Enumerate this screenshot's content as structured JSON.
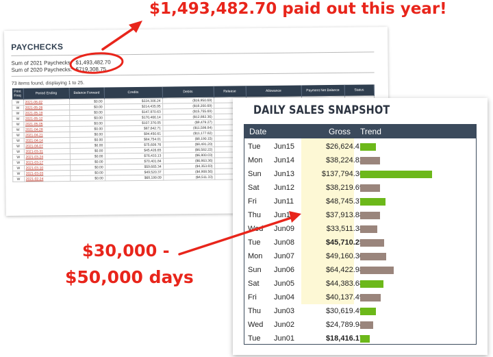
{
  "annotations": {
    "top": "$1,493,482.70 paid out this year!",
    "bottom_line1": "$30,000 -",
    "bottom_line2": "$50,000 days"
  },
  "paychecks": {
    "title": "PAYCHECKS",
    "sum_2021_label": "Sum of 2021 Paychecks:",
    "sum_2021_value": "$1,493,482.70",
    "sum_2020_label": "Sum of 2020 Paychecks:",
    "sum_2020_value": "$719,308.75",
    "items_found": "73 items found, displaying 1 to 25.",
    "columns": [
      "Print Freq",
      "Period Ending",
      "Balance Forward",
      "Credits",
      "Debits",
      "Release",
      "Allowance",
      "Payment Net Balance",
      "Status"
    ],
    "rows": [
      [
        "W",
        "2021-06-02",
        "$0.00",
        "$224,306.24",
        "($16,950.69)"
      ],
      [
        "W",
        "2021-05-26",
        "$0.00",
        "$214,435.95",
        "($18,200.69)"
      ],
      [
        "W",
        "2021-05-19",
        "$0.00",
        "$147,870.63",
        "($15,755.69)"
      ],
      [
        "W",
        "2021-05-12",
        "$0.00",
        "$170,466.14",
        "($12,882.36)"
      ],
      [
        "W",
        "2021-05-05",
        "$0.00",
        "$107,376.05",
        "($9,479.27)"
      ],
      [
        "W",
        "2021-04-28",
        "$0.00",
        "$87,642.71",
        "($11,598.84)"
      ],
      [
        "W",
        "2021-04-21",
        "$0.00",
        "$94,450.61",
        "($11,177.82)"
      ],
      [
        "W",
        "2021-04-14",
        "$0.00",
        "$84,754.01",
        "($8,190.15)"
      ],
      [
        "W",
        "2021-04-07",
        "$0.00",
        "$75,609.76",
        "($8,491.20)"
      ],
      [
        "W",
        "2021-03-31",
        "$0.00",
        "$45,426.65",
        "($6,582.22)"
      ],
      [
        "W",
        "2021-03-24",
        "$0.00",
        "$76,433.13",
        "($6,800.03)"
      ],
      [
        "W",
        "2021-03-17",
        "$0.00",
        "$70,401.84",
        "($6,863.36)"
      ],
      [
        "W",
        "2021-03-10",
        "$0.00",
        "$59,665.34",
        "($4,353.83)"
      ],
      [
        "W",
        "2021-03-03",
        "$0.00",
        "$49,520.37",
        "($4,908.56)"
      ],
      [
        "W",
        "2021-02-24",
        "$0.00",
        "$68,199.09",
        "($4,511.33)"
      ]
    ]
  },
  "sales": {
    "title": "DAILY SALES SNAPSHOT",
    "headers": {
      "date": "Date",
      "gross": "Gross",
      "trend": "Trend"
    },
    "colors": {
      "header": "#3b4a5c",
      "up": "#6cb81a",
      "down": "#9a857c",
      "highlight": "#fdf8d5",
      "annotation": "#e8251b"
    },
    "rows": [
      {
        "day": "Tue",
        "date": "Jun15",
        "gross": "$26,624.41",
        "trend": "up",
        "trend_level": 0.22
      },
      {
        "day": "Mon",
        "date": "Jun14",
        "gross": "$38,224.82",
        "trend": "down",
        "trend_level": 0.28
      },
      {
        "day": "Sun",
        "date": "Jun13",
        "gross": "$137,794.36",
        "trend": "up",
        "trend_level": 1.0
      },
      {
        "day": "Sat",
        "date": "Jun12",
        "gross": "$38,219.69",
        "trend": "down",
        "trend_level": 0.28
      },
      {
        "day": "Fri",
        "date": "Jun11",
        "gross": "$48,745.37",
        "trend": "up",
        "trend_level": 0.35
      },
      {
        "day": "Thu",
        "date": "Jun10",
        "gross": "$37,913.88",
        "trend": "down",
        "trend_level": 0.28
      },
      {
        "day": "Wed",
        "date": "Jun09",
        "gross": "$33,511.38",
        "trend": "down",
        "trend_level": 0.24
      },
      {
        "day": "Tue",
        "date": "Jun08",
        "gross": "$45,710.25",
        "trend": "down",
        "trend_level": 0.33,
        "bold": true
      },
      {
        "day": "Mon",
        "date": "Jun07",
        "gross": "$49,160.30",
        "trend": "down",
        "trend_level": 0.36
      },
      {
        "day": "Sun",
        "date": "Jun06",
        "gross": "$64,422.98",
        "trend": "down",
        "trend_level": 0.47
      },
      {
        "day": "Sat",
        "date": "Jun05",
        "gross": "$44,383.68",
        "trend": "up",
        "trend_level": 0.32
      },
      {
        "day": "Fri",
        "date": "Jun04",
        "gross": "$40,137.49",
        "trend": "down",
        "trend_level": 0.29
      },
      {
        "day": "Thu",
        "date": "Jun03",
        "gross": "$30,619.49",
        "trend": "up",
        "trend_level": 0.22
      },
      {
        "day": "Wed",
        "date": "Jun02",
        "gross": "$24,789.94",
        "trend": "down",
        "trend_level": 0.18
      },
      {
        "day": "Tue",
        "date": "Jun01",
        "gross": "$18,416.17",
        "trend": "up",
        "trend_level": 0.13,
        "bold": true
      }
    ]
  }
}
